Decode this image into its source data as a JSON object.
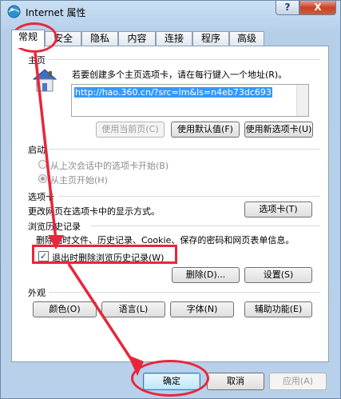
{
  "window": {
    "title": "Internet 属性",
    "help_glyph": "?",
    "close_glyph": "X"
  },
  "tabs": [
    "常规",
    "安全",
    "隐私",
    "内容",
    "连接",
    "程序",
    "高级"
  ],
  "homepage": {
    "group_label": "主页",
    "instruction": "若要创建多个主页选项卡，请在每行键入一个地址(R)。",
    "url": "http://hao.360.cn/?src=lm&ls=n4eb73dc693",
    "btn_use_current": "使用当前页(C)",
    "btn_use_default": "使用默认值(F)",
    "btn_use_new_tab": "使用新选项卡(U)"
  },
  "startup": {
    "group_label": "启动",
    "opt_last_session": "从上次会话中的选项卡开始(B)",
    "opt_homepage": "从主页开始(H)"
  },
  "tabs_group": {
    "group_label": "选项卡",
    "desc": "更改网页在选项卡中的显示方式。",
    "btn": "选项卡(T)"
  },
  "history": {
    "group_label": "浏览历史记录",
    "desc": "删除临时文件、历史记录、Cookie、保存的密码和网页表单信息。",
    "checkbox_label": "退出时删除浏览历史记录(W)",
    "check_mark": "✓",
    "btn_delete": "删除(D)...",
    "btn_settings": "设置(S)"
  },
  "appearance": {
    "group_label": "外观",
    "btn_colors": "颜色(O)",
    "btn_languages": "语言(L)",
    "btn_fonts": "字体(N)",
    "btn_accessibility": "辅助功能(E)"
  },
  "footer": {
    "ok": "确定",
    "cancel": "取消",
    "apply": "应用(A)"
  },
  "colors": {
    "annotation": "#e8263a",
    "selection": "#3399ff"
  }
}
